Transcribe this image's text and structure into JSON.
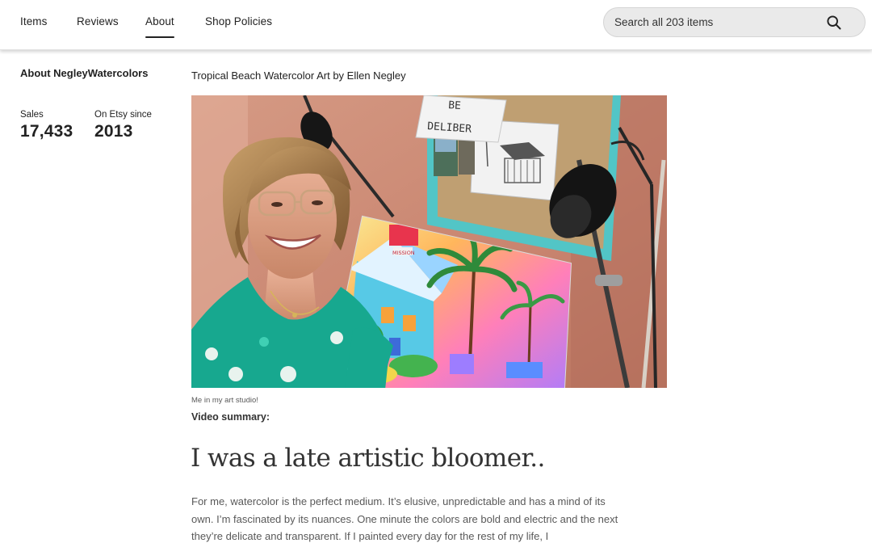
{
  "nav": {
    "tabs": [
      {
        "label": "Items",
        "active": false
      },
      {
        "label": "Reviews",
        "active": false
      },
      {
        "label": "About",
        "active": true
      },
      {
        "label": "Shop Policies",
        "active": false
      }
    ],
    "search": {
      "placeholder": "Search all 203 items",
      "icon": "search-icon"
    }
  },
  "sidebar": {
    "shop_title": "About NegleyWatercolors",
    "stats": [
      {
        "label": "Sales",
        "value": "17,433"
      },
      {
        "label": "On Etsy since",
        "value": "2013"
      }
    ]
  },
  "main": {
    "headline": "Tropical Beach Watercolor Art by Ellen Negley",
    "photo": {
      "caption": "Me in my art studio!",
      "note_text_line1": "BE",
      "note_text_line2": "DELIBER",
      "canvas_sign": "MISSION"
    },
    "video_label": "Video summary:",
    "story_title": "I was a late artistic bloomer..",
    "story_body": "For me, watercolor is the perfect medium. It’s elusive, unpredictable and has a mind of its own. I’m fascinated by its nuances. One minute the colors are bold and electric and the next they’re delicate and transparent. If I painted every day for the rest of my life, I"
  },
  "colors": {
    "accent": "#222222",
    "search_bg": "#eaeaea",
    "photo_wall": "#c98b75",
    "shirt": "#17a88f"
  }
}
